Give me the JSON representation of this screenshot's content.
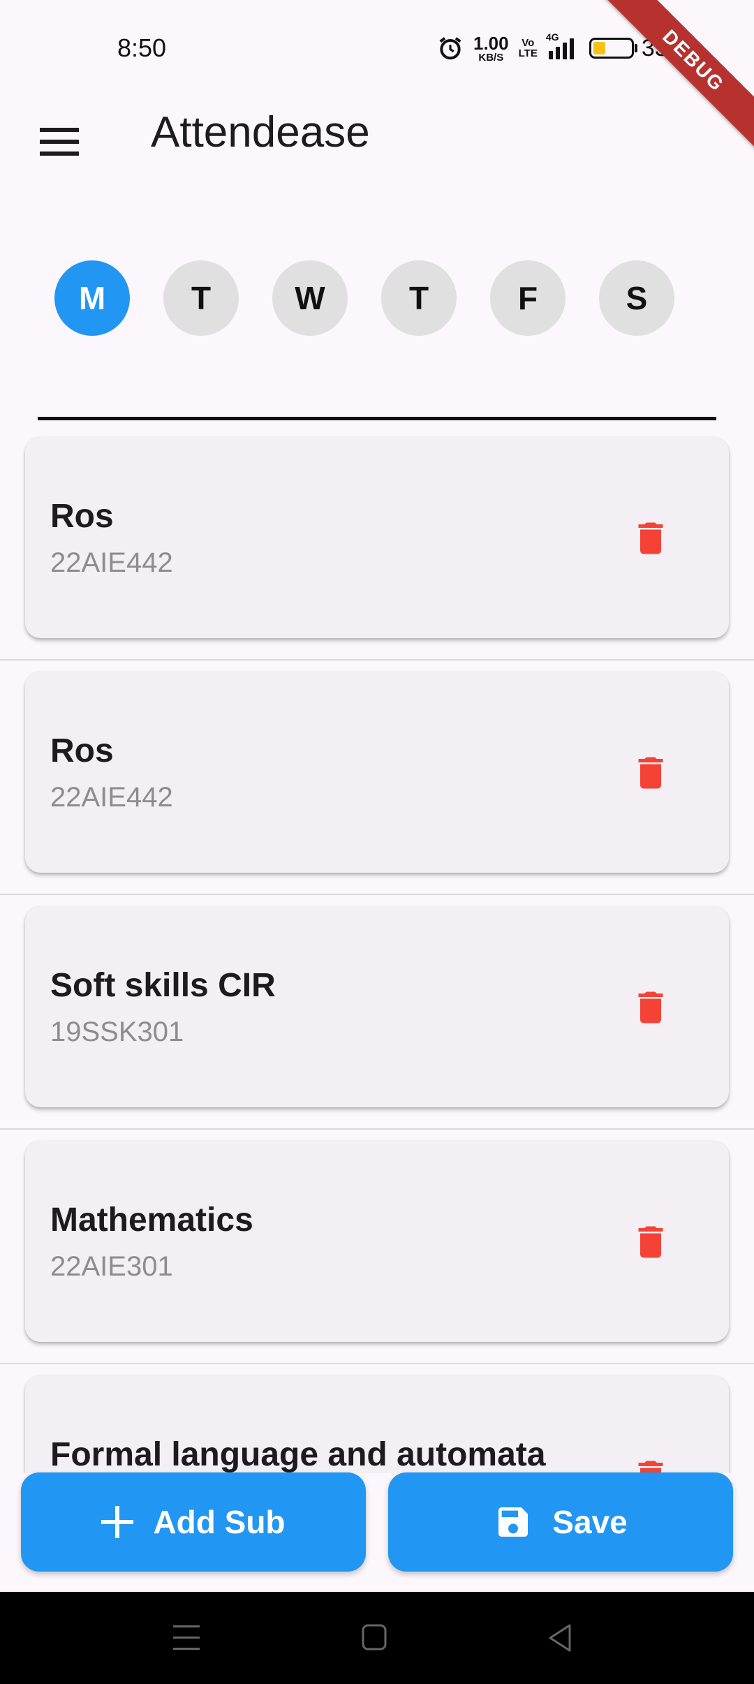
{
  "status_bar": {
    "time": "8:50",
    "net_speed_value": "1.00",
    "net_speed_unit": "KB/S",
    "volte_top": "Vo",
    "volte_bottom": "LTE",
    "network": "4G",
    "battery_percent": "33%",
    "battery_level": 0.33
  },
  "debug_banner": "DEBUG",
  "app_bar": {
    "title": "Attendease",
    "menu_icon": "hamburger-menu-icon"
  },
  "days": [
    {
      "label": "M",
      "active": true
    },
    {
      "label": "T",
      "active": false
    },
    {
      "label": "W",
      "active": false
    },
    {
      "label": "T",
      "active": false
    },
    {
      "label": "F",
      "active": false
    },
    {
      "label": "S",
      "active": false
    }
  ],
  "subjects": [
    {
      "name": "Ros",
      "code": "22AIE442"
    },
    {
      "name": "Ros",
      "code": "22AIE442"
    },
    {
      "name": "Soft skills CIR",
      "code": "19SSK301"
    },
    {
      "name": "Mathematics",
      "code": "22AIE301"
    },
    {
      "name": "Formal language and automata",
      "code": ""
    }
  ],
  "actions": {
    "add_label": "Add Sub",
    "save_label": "Save"
  },
  "colors": {
    "primary": "#2196f3",
    "delete": "#f44336",
    "background": "#fcf7fc",
    "card": "#f4eff5"
  }
}
